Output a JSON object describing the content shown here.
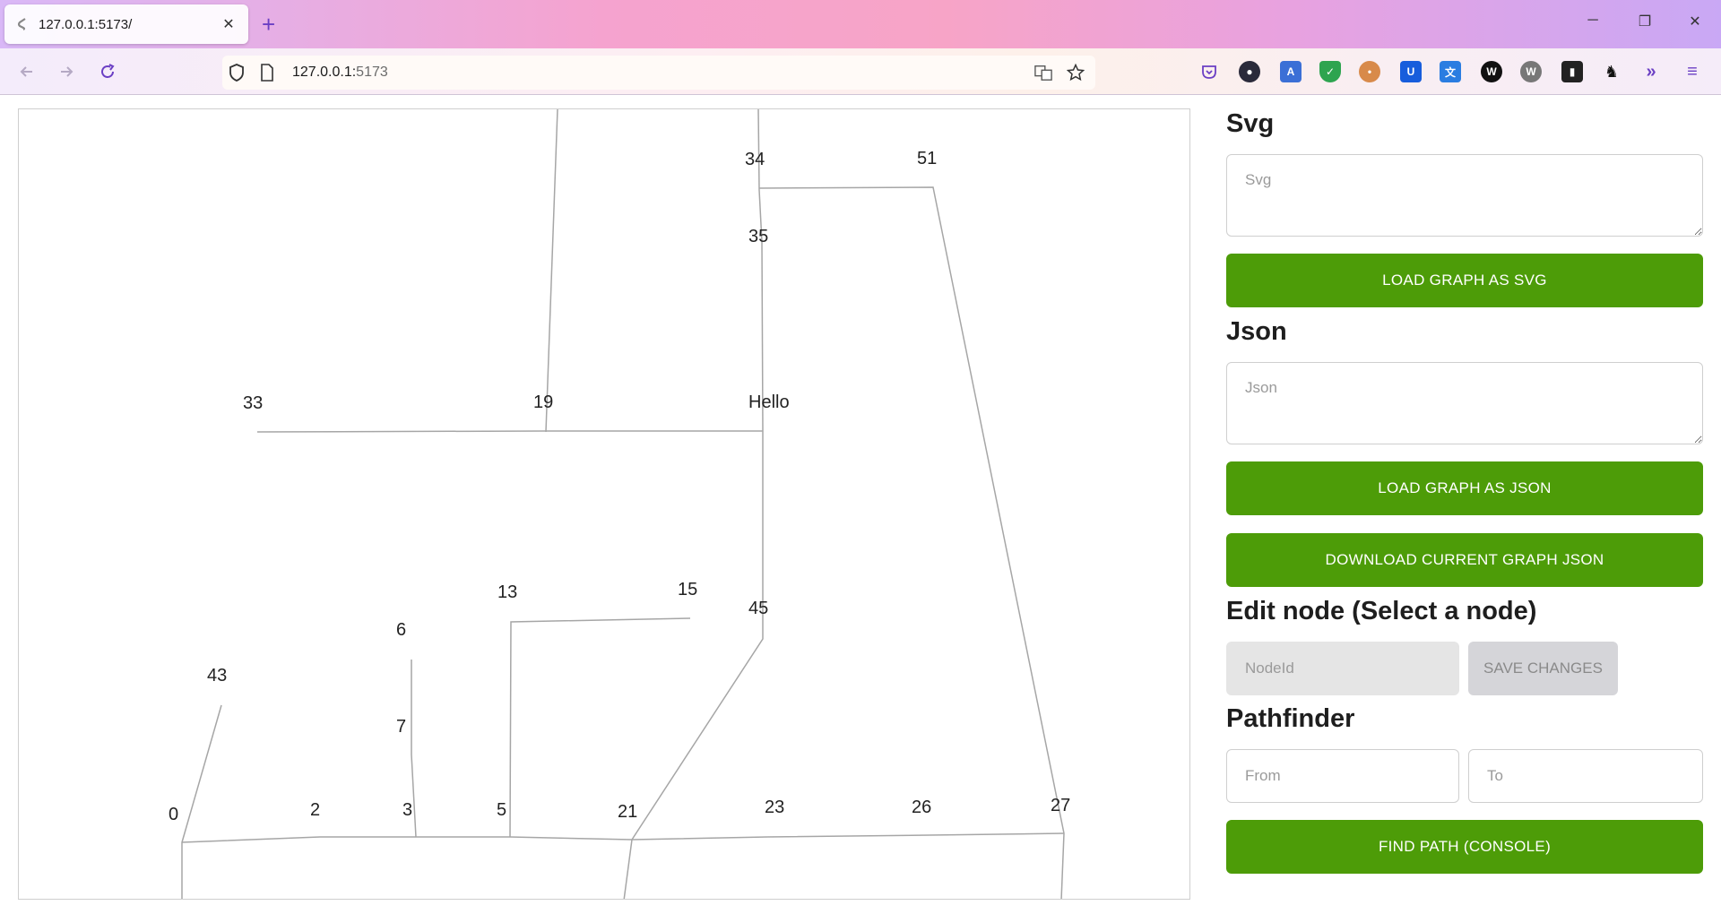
{
  "browser": {
    "tab_title": "127.0.0.1:5173/",
    "url_host": "127.0.0.1:",
    "url_port": "5173",
    "accent": "#6b3fc4"
  },
  "graph": {
    "edge_color": "#a6a6a6",
    "nodes": [
      {
        "id": "n34",
        "label": "34"
      },
      {
        "id": "n51",
        "label": "51"
      },
      {
        "id": "n35",
        "label": "35"
      },
      {
        "id": "n33",
        "label": "33"
      },
      {
        "id": "n19",
        "label": "19"
      },
      {
        "id": "nHello",
        "label": "Hello"
      },
      {
        "id": "n13",
        "label": "13"
      },
      {
        "id": "n15",
        "label": "15"
      },
      {
        "id": "n45",
        "label": "45"
      },
      {
        "id": "n6",
        "label": "6"
      },
      {
        "id": "n43",
        "label": "43"
      },
      {
        "id": "n7",
        "label": "7"
      },
      {
        "id": "n0",
        "label": "0"
      },
      {
        "id": "n2",
        "label": "2"
      },
      {
        "id": "n3",
        "label": "3"
      },
      {
        "id": "n5",
        "label": "5"
      },
      {
        "id": "n21",
        "label": "21"
      },
      {
        "id": "n23",
        "label": "23"
      },
      {
        "id": "n26",
        "label": "26"
      },
      {
        "id": "n27",
        "label": "27"
      }
    ]
  },
  "panel": {
    "svg_heading": "Svg",
    "svg_placeholder": "Svg",
    "load_svg_button": "LOAD GRAPH AS SVG",
    "json_heading": "Json",
    "json_placeholder": "Json",
    "load_json_button": "LOAD GRAPH AS JSON",
    "download_button": "DOWNLOAD CURRENT GRAPH JSON",
    "edit_heading": "Edit node (Select a node)",
    "nodeid_placeholder": "NodeId",
    "save_button": "SAVE CHANGES",
    "pathfinder_heading": "Pathfinder",
    "from_placeholder": "From",
    "to_placeholder": "To",
    "find_button": "FIND PATH (CONSOLE)",
    "button_color": "#4d9c08"
  }
}
